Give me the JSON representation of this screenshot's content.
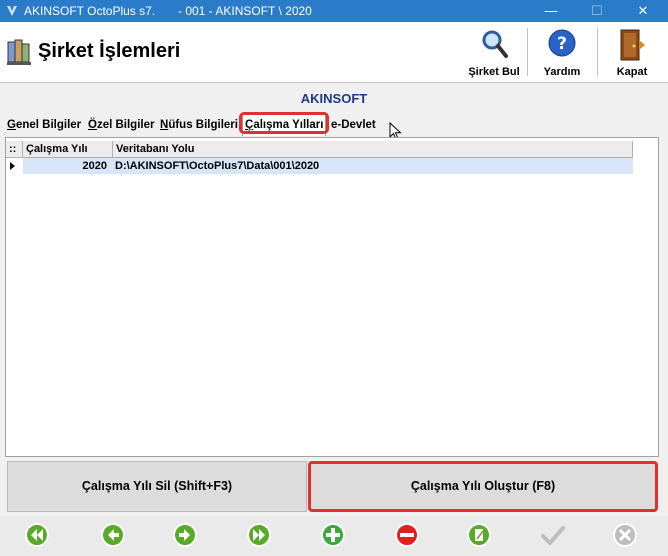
{
  "window": {
    "app_title": "AKINSOFT OctoPlus s7.",
    "doc_title": "- 001 - AKINSOFT \\ 2020",
    "minimize_glyph": "—",
    "maximize_glyph": "☐",
    "close_glyph": "✕"
  },
  "header": {
    "title": "Şirket İşlemleri",
    "tools": [
      {
        "label": "Şirket Bul",
        "icon": "magnifier-icon"
      },
      {
        "label": "Yardım",
        "icon": "help-icon"
      },
      {
        "label": "Kapat",
        "icon": "exit-door-icon"
      }
    ]
  },
  "company_name": "AKINSOFT",
  "tabs": [
    {
      "label": "Genel Bilgiler",
      "underline": "G",
      "rest": "enel Bilgiler"
    },
    {
      "label": "Özel Bilgiler",
      "underline": "Ö",
      "rest": "zel Bilgiler"
    },
    {
      "label": "Nüfus Bilgileri",
      "underline": "N",
      "rest": "üfus Bilgileri"
    },
    {
      "label": "Çalışma Yılları",
      "underline": "Ç",
      "rest": "alışma Yılları",
      "active": true
    },
    {
      "label": "e-Devlet",
      "underline": "",
      "rest": "e-Devlet"
    }
  ],
  "table": {
    "indicator_header": "::",
    "columns": [
      "Çalışma Yılı",
      "Veritabanı Yolu"
    ],
    "rows": [
      {
        "year": "2020",
        "path": "D:\\AKINSOFT\\OctoPlus7\\Data\\001\\2020"
      }
    ]
  },
  "buttons": {
    "delete_year": "Çalışma Yılı Sil (Shift+F3)",
    "create_year": "Çalışma Yılı Oluştur (F8)"
  },
  "nav": [
    {
      "name": "first-record-icon",
      "color": "#5aaa2a"
    },
    {
      "name": "previous-record-icon",
      "color": "#5aaa2a"
    },
    {
      "name": "next-record-icon",
      "color": "#5aaa2a"
    },
    {
      "name": "last-record-icon",
      "color": "#5aaa2a"
    },
    {
      "name": "add-record-icon",
      "color": "#3aaa3a"
    },
    {
      "name": "delete-record-icon",
      "color": "#e02020"
    },
    {
      "name": "edit-record-icon",
      "color": "#5aaa2a"
    },
    {
      "name": "confirm-icon",
      "color": "#bdbdbd"
    },
    {
      "name": "cancel-icon",
      "color": "#bdbdbd"
    }
  ],
  "colors": {
    "titlebar": "#2a7bc8",
    "highlight": "#e03030",
    "company_text": "#1a3a8a",
    "selected_row": "#d6e6f8"
  }
}
